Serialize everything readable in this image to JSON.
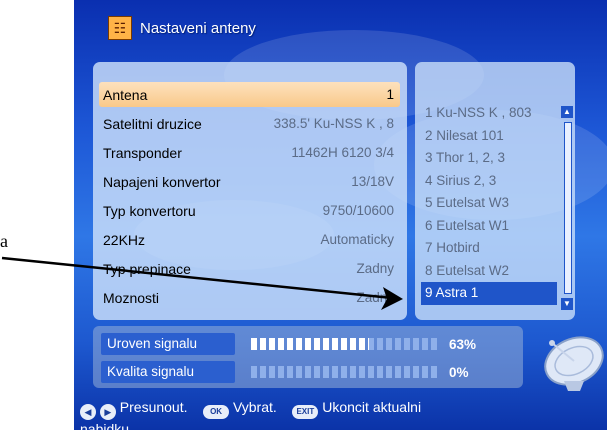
{
  "window": {
    "title": "Nastaveni anteny"
  },
  "outside_text": "a",
  "settings": [
    {
      "label": "Antena",
      "value": "1",
      "selected": true
    },
    {
      "label": "Satelitni druzice",
      "value": "338.5' Ku-NSS K , 8"
    },
    {
      "label": "Transponder",
      "value": "11462H 6120 3/4"
    },
    {
      "label": "Napajeni konvertor",
      "value": "13/18V"
    },
    {
      "label": "Typ konvertoru",
      "value": "9750/10600"
    },
    {
      "label": "22KHz",
      "value": "Automaticky"
    },
    {
      "label": "Typ prepinace",
      "value": "Zadny"
    },
    {
      "label": "Moznosti",
      "value": "Zadny"
    }
  ],
  "satellites": [
    "1 Ku-NSS K , 803",
    "2 Nilesat 101",
    "3 Thor 1, 2, 3",
    "4 Sirius 2, 3",
    "5 Eutelsat W3",
    "6 Eutelsat W1",
    "7 Hotbird",
    "8 Eutelsat W2",
    "9 Astra 1"
  ],
  "selected_satellite_index": 8,
  "signal": [
    {
      "label": "Uroven signalu",
      "percent_text": "63%",
      "level": 0.63
    },
    {
      "label": "Kvalita signalu",
      "percent_text": "0%",
      "level": 0.0
    }
  ],
  "footer": {
    "move_label": "Presunout.",
    "ok_key": "OK",
    "ok_label": "Vybrat.",
    "exit_key": "EXIT",
    "exit_label": "Ukoncit aktualni",
    "exit_label_2": "nabidku"
  },
  "colors": {
    "highlight_row": "#f9c98a",
    "selection_blue": "#1f55c9",
    "background_blue": "#1d57d6"
  }
}
